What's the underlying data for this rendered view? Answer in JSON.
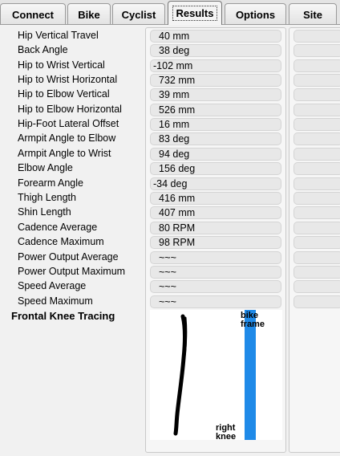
{
  "tabs": [
    {
      "label": "Connect",
      "active": false
    },
    {
      "label": "Bike",
      "active": false
    },
    {
      "label": "Cyclist",
      "active": false
    },
    {
      "label": "Results",
      "active": true
    },
    {
      "label": "Options",
      "active": false
    },
    {
      "label": "Site",
      "active": false
    }
  ],
  "results": [
    {
      "label": "Hip Vertical Travel",
      "value": "40 mm"
    },
    {
      "label": "Back Angle",
      "value": "38 deg"
    },
    {
      "label": "Hip to Wrist Vertical",
      "value": "-102 mm"
    },
    {
      "label": "Hip to Wrist Horizontal",
      "value": "732 mm"
    },
    {
      "label": "Hip to Elbow Vertical",
      "value": "39 mm"
    },
    {
      "label": "Hip to Elbow Horizontal",
      "value": "526 mm"
    },
    {
      "label": "Hip-Foot Lateral Offset",
      "value": "16 mm"
    },
    {
      "label": "Armpit Angle to Elbow",
      "value": "83 deg"
    },
    {
      "label": "Armpit Angle to Wrist",
      "value": "94 deg"
    },
    {
      "label": "Elbow Angle",
      "value": "156 deg"
    },
    {
      "label": "Forearm Angle",
      "value": "-34 deg"
    },
    {
      "label": "Thigh Length",
      "value": "416 mm"
    },
    {
      "label": "Shin Length",
      "value": "407 mm"
    },
    {
      "label": "Cadence Average",
      "value": "80 RPM"
    },
    {
      "label": "Cadence Maximum",
      "value": "98 RPM"
    },
    {
      "label": "Power Output Average",
      "value": "~~~"
    },
    {
      "label": "Power Output Maximum",
      "value": "~~~"
    },
    {
      "label": "Speed Average",
      "value": "~~~"
    },
    {
      "label": "Speed Maximum",
      "value": "~~~"
    }
  ],
  "knee_tracing": {
    "title": "Frontal Knee Tracing",
    "bike_frame_label_line1": "bike",
    "bike_frame_label_line2": "frame",
    "right_knee_label_line1": "right",
    "right_knee_label_line2": "knee",
    "frame_color": "#1f8ae8",
    "trace_color": "#000000"
  }
}
